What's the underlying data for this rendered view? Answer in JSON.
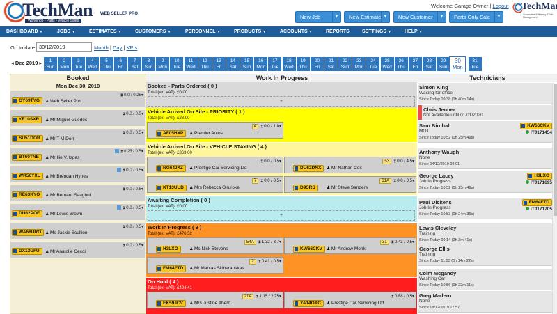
{
  "header": {
    "brand": "TechMan",
    "tagline": "Workshop • Parts • Vehicle Sales",
    "product": "WEB SELLER PRO",
    "product_accent": "PRO",
    "welcome": "Welcome Garage Owner |",
    "logout": "Logout",
    "buttons": [
      "New Job",
      "New Estimate",
      "New Customer",
      "Parts Only Sale"
    ],
    "logo2_brand": "TechMan",
    "logo2_tag": "Automotive Efficiency & Job Management"
  },
  "nav": [
    "DASHBOARD",
    "JOBS",
    "ESTIMATES",
    "CUSTOMERS",
    "PERSONNEL",
    "PRODUCTS",
    "ACCOUNTS",
    "REPORTS",
    "SETTINGS",
    "HELP"
  ],
  "toolbar": {
    "goto_label": "Go to date:",
    "goto_value": "30/12/2019",
    "link_month": "Month",
    "link_day": "Day",
    "link_kpis": "KPIs",
    "sep": "|"
  },
  "datestrip": {
    "month": "◂ Dec 2019 ▸",
    "days": [
      [
        "1",
        "Sun"
      ],
      [
        "2",
        "Mon"
      ],
      [
        "3",
        "Tue"
      ],
      [
        "4",
        "Wed"
      ],
      [
        "5",
        "Thu"
      ],
      [
        "6",
        "Fri"
      ],
      [
        "7",
        "Sat"
      ],
      [
        "8",
        "Sun"
      ],
      [
        "9",
        "Mon"
      ],
      [
        "10",
        "Tue"
      ],
      [
        "11",
        "Wed"
      ],
      [
        "12",
        "Thu"
      ],
      [
        "13",
        "Fri"
      ],
      [
        "14",
        "Sat"
      ],
      [
        "15",
        "Sun"
      ],
      [
        "16",
        "Mon"
      ],
      [
        "17",
        "Tue"
      ],
      [
        "18",
        "Wed"
      ],
      [
        "19",
        "Thu"
      ],
      [
        "20",
        "Fri"
      ],
      [
        "21",
        "Sat"
      ],
      [
        "22",
        "Sun"
      ],
      [
        "23",
        "Mon"
      ],
      [
        "24",
        "Tue"
      ],
      [
        "25",
        "Wed"
      ],
      [
        "26",
        "Thu"
      ],
      [
        "27",
        "Fri"
      ],
      [
        "28",
        "Sat"
      ],
      [
        "29",
        "Sun"
      ],
      [
        "30",
        "Mon"
      ],
      [
        "31",
        "Tue"
      ]
    ],
    "active_day": "30"
  },
  "columns": {
    "booked": "Booked",
    "booked_date": "Mon Dec 30, 2019",
    "wip": "Work In Progress",
    "tech": "Technicians"
  },
  "booked": [
    {
      "plate": "GY69TYG",
      "customer": "Web Seller Pro",
      "hours": "0.0 / 0.25",
      "cal": false
    },
    {
      "plate": "YE10SXR",
      "customer": "Mr Miguel Guedes",
      "hours": "0.0 / 0.5",
      "cal": false
    },
    {
      "plate": "SU51DOR",
      "customer": "Mr T M Dorr",
      "hours": "0.0 / 0.5",
      "cal": false
    },
    {
      "plate": "BT60TNE",
      "customer": "Mr Ilie V. Ispas",
      "hours": "0.23 / 0.5",
      "cal": true
    },
    {
      "plate": "WR56YXL",
      "customer": "Mr Brendan Hynes",
      "hours": "0.0 / 0.5",
      "cal": true
    },
    {
      "plate": "RE63KYO",
      "customer": "Mr Bernard Saagbul",
      "hours": "0.0 / 0.5",
      "cal": false
    },
    {
      "plate": "DU62POF",
      "customer": "Mr Lewis Brown",
      "hours": "0.0 / 0.5",
      "cal": true
    },
    {
      "plate": "WA66URO",
      "customer": "Ms Jackie Scullion",
      "hours": "0.0 / 0.5",
      "cal": false
    },
    {
      "plate": "DX13UFU",
      "customer": "Mr Anatolie Cecoi",
      "hours": "0.0 / 0.5",
      "cal": false
    }
  ],
  "wip": {
    "booked_parts": {
      "title": "Booked - Parts Ordered ( 0 )",
      "total": "Total (ex. VAT): £0.00",
      "add": "+",
      "color": "#d9d9d9"
    },
    "priority": {
      "title": "Vehicle Arrived On Site - PRIORITY ( 1 )",
      "total": "Total (ex. VAT): £28.00",
      "color": "#ffff00",
      "jobs": [
        {
          "plate": "AF05HXP",
          "customer": "Premier Autos",
          "badge": "4",
          "hours": "0.0 / 1.0"
        }
      ]
    },
    "staying": {
      "title": "Vehicle Arrived On Site - VEHICLE STAYING ( 4 )",
      "total": "Total (ex. VAT): £363.00",
      "color": "#fff59a",
      "jobs": [
        {
          "plate": "NG64JXZ",
          "customer": "Prestige Car Servicing Ltd",
          "badge": "",
          "hours": "0.0 / 0.5"
        },
        {
          "plate": "DU62DNX",
          "customer": "Mr Nathan Cox",
          "badge": "53",
          "hours": "0.0 / 4.5"
        },
        {
          "plate": "KT13UUD",
          "customer": "Mrs Rebecca O'ruroke",
          "badge": "7",
          "hours": "0.0 / 0.5"
        },
        {
          "plate": "D9SRS",
          "customer": "Mr Steve Sanders",
          "badge": "31A",
          "hours": "0.0 / 0.5"
        }
      ]
    },
    "awaiting": {
      "title": "Awaiting Completion ( 0 )",
      "total": "Total (ex. VAT): £0.00",
      "add": "+",
      "color": "#b8ecef"
    },
    "inprogress": {
      "title": "Work In Progress ( 3 )",
      "total": "Total (ex. VAT): £476.52",
      "color": "#ff9224",
      "jobs": [
        {
          "plate": "H3LXO",
          "customer": "Ms Nick Stevens",
          "badge": "54A",
          "hours": "1.32 / 3.7"
        },
        {
          "plate": "KW66CKV",
          "customer": "Mr Andrew Monk",
          "badge": "31",
          "hours": "0.43 / 0.5"
        },
        {
          "plate": "FM64FTD",
          "customer": "Mr Mantas Skiberauskas",
          "badge": "2",
          "hours": "0.41 / 0.5"
        }
      ]
    },
    "onhold": {
      "title": "On Hold ( 4 )",
      "total": "Total (ex. VAT): £404.41",
      "color": "#ff1d1d",
      "jobs": [
        {
          "plate": "EK59JCV",
          "customer": "Mrs Justine Ahern",
          "badge": "21A",
          "hours": "1.15 / 2.75"
        },
        {
          "plate": "YA14OAC",
          "customer": "Prestige Car Servicing Ltd",
          "badge": "",
          "hours": "0.88 / 0.5"
        }
      ]
    }
  },
  "technicians": [
    {
      "name": "Simon King",
      "status": "Waiting for office",
      "since": "Since Today 09:38 (1h 40m 14s)",
      "job": ""
    },
    {
      "name": "Chris Jenner",
      "status": "Not available until 01/01/2020",
      "since": "",
      "job": ""
    },
    {
      "name": "Sam Birchall",
      "status": "MOT",
      "since": "Since Today 10:52 (0h 25m 49s)",
      "plate": "KW66CKV",
      "job": "ITJ171454"
    },
    {
      "name": "Anthony Waugh",
      "status": "None",
      "since": "Since 04/12/2019 08:01",
      "job": ""
    },
    {
      "name": "George Lacey",
      "status": "Job In Progress",
      "since": "Since Today 10:52 (0h 25m 49s)",
      "plate": "H3LXO",
      "job": "ITJ171695"
    },
    {
      "name": "Paul Dickens",
      "status": "Job In Progress",
      "since": "Since Today 10:53 (0h 24m 36s)",
      "plate": "FM64FTD",
      "job": "ITJ171705"
    },
    {
      "name": "Lewis Cleveley",
      "status": "Training",
      "since": "Since Today 09:14 (2h 3m 41s)",
      "job": ""
    },
    {
      "name": "George Ellis",
      "status": "Training",
      "since": "Since Today 11:03 (0h 14m 22s)",
      "job": ""
    },
    {
      "name": "Colm Mcgandy",
      "status": "Washing Car",
      "since": "Since Today 10:56 (0h 22m 11s)",
      "job": ""
    },
    {
      "name": "Greg Madero",
      "status": "None",
      "since": "Since 18/12/2019 17:57",
      "job": ""
    }
  ]
}
